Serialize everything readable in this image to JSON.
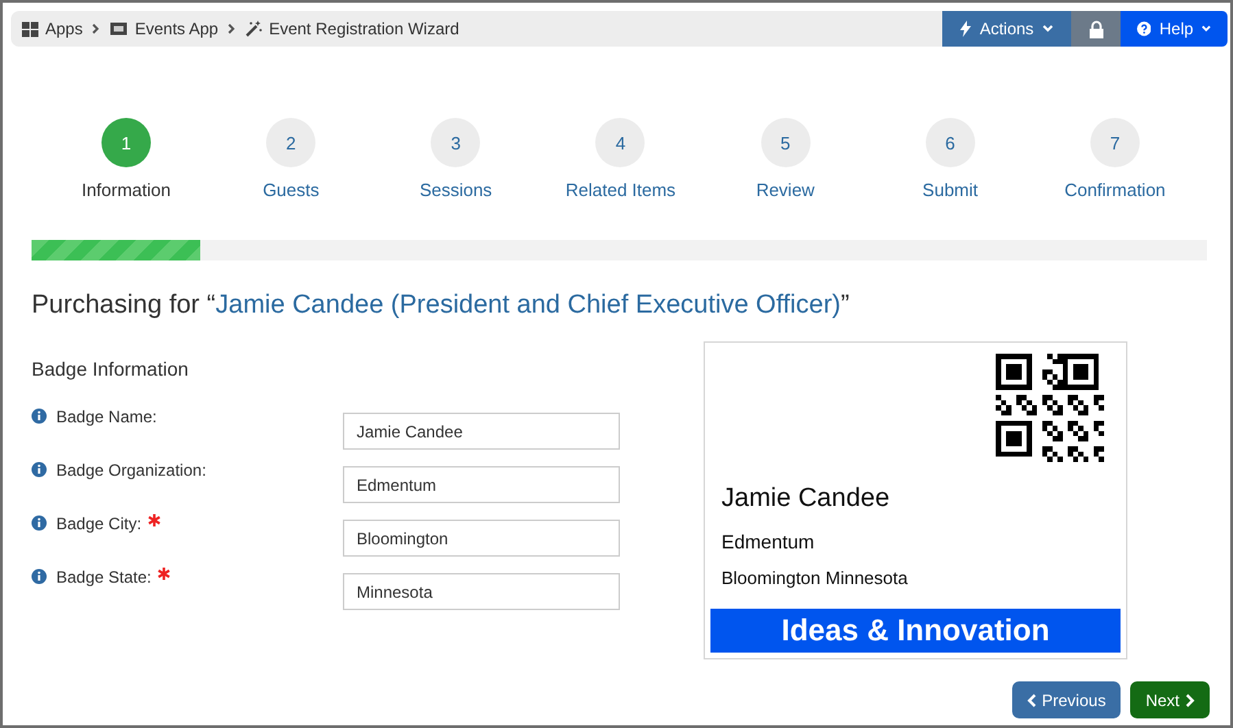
{
  "breadcrumb": [
    {
      "kind": "apps",
      "label": "Apps"
    },
    {
      "kind": "app",
      "label": "Events App"
    },
    {
      "kind": "wizard",
      "label": "Event Registration Wizard"
    }
  ],
  "toolbar": {
    "actions": "Actions",
    "help": "Help"
  },
  "steps": [
    {
      "number": "1",
      "label": "Information",
      "selected": true
    },
    {
      "number": "2",
      "label": "Guests",
      "selected": false
    },
    {
      "number": "3",
      "label": "Sessions",
      "selected": false
    },
    {
      "number": "4",
      "label": "Related Items",
      "selected": false
    },
    {
      "number": "5",
      "label": "Review",
      "selected": false
    },
    {
      "number": "6",
      "label": "Submit",
      "selected": false
    },
    {
      "number": "7",
      "label": "Confirmation",
      "selected": false
    }
  ],
  "progress": {
    "level": 0.143
  },
  "heading": {
    "prefix": "Purchasing for “",
    "name": "Jamie Candee (President and Chief Executive Officer)",
    "suffix": "”"
  },
  "section_title": "Badge Information",
  "fields": [
    {
      "label": "Badge Name:",
      "value": "Jamie Candee",
      "required": false
    },
    {
      "label": "Badge Organization:",
      "value": "Edmentum",
      "required": false
    },
    {
      "label": "Badge City:",
      "value": "Bloomington",
      "required": true
    },
    {
      "label": "Badge State:",
      "value": "Minnesota",
      "required": true
    }
  ],
  "badge": {
    "name": "Jamie Candee",
    "organization": "Edmentum",
    "location": "Bloomington Minnesota",
    "banner": "Ideas & Innovation"
  },
  "buttons": {
    "previous": "Previous",
    "next": "Next"
  }
}
